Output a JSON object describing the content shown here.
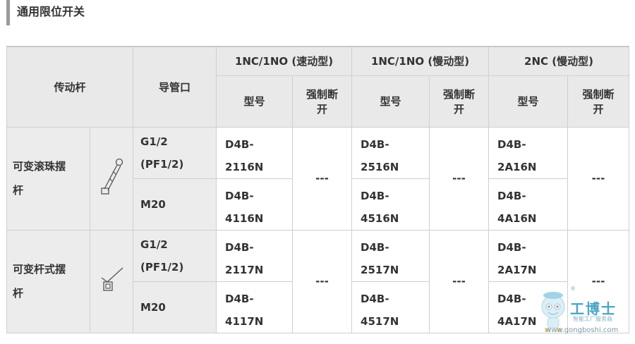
{
  "section_title": "通用限位开关",
  "header": {
    "actuator": "传动杆",
    "conduit": "导管口",
    "groups": [
      "1NC/1NO (速动型)",
      "1NC/1NO (慢动型)",
      "2NC (慢动型)"
    ],
    "model_label": "型号",
    "forced_break": [
      "强制断",
      "开"
    ]
  },
  "rows": [
    {
      "lever": [
        "可变滚珠摆",
        "杆"
      ],
      "icon": "roller-lever-icon",
      "ports": [
        {
          "port": [
            "G1/2",
            "(PF1/2)"
          ],
          "models": [
            [
              "D4B-",
              "2116N"
            ],
            [
              "D4B-",
              "2516N"
            ],
            [
              "D4B-",
              "2A16N"
            ]
          ]
        },
        {
          "port": [
            "M20"
          ],
          "models": [
            [
              "D4B-",
              "4116N"
            ],
            [
              "D4B-",
              "4516N"
            ],
            [
              "D4B-",
              "4A16N"
            ]
          ]
        }
      ],
      "forced": [
        "---",
        "---",
        "---"
      ]
    },
    {
      "lever": [
        "可变杆式摆",
        "杆"
      ],
      "icon": "rod-lever-icon",
      "ports": [
        {
          "port": [
            "G1/2",
            "(PF1/2)"
          ],
          "models": [
            [
              "D4B-",
              "2117N"
            ],
            [
              "D4B-",
              "2517N"
            ],
            [
              "D4B-",
              "2A17N"
            ]
          ]
        },
        {
          "port": [
            "M20"
          ],
          "models": [
            [
              "D4B-",
              "4117N"
            ],
            [
              "D4B-",
              "4517N"
            ],
            [
              "D4B-",
              "4A17N"
            ]
          ]
        }
      ],
      "forced": [
        "---",
        "---",
        "---"
      ]
    }
  ],
  "watermark": {
    "name": "工博士",
    "sub": "智能工厂服务商",
    "url": "www.gongboshi.com",
    "reg": "®"
  }
}
